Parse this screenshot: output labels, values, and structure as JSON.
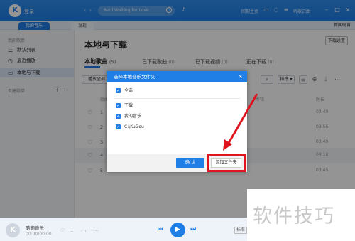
{
  "topbar": {
    "login_label": "登录",
    "search_placeholder": "Avril Waiting for Love",
    "link_1": "回到主页",
    "link_2": "听歌识曲"
  },
  "tabs": [
    {
      "label": "我的音乐"
    },
    {
      "label": "发现"
    }
  ],
  "new_window_label": "新闻码首",
  "sidebar": {
    "section_my": "我的歌单",
    "items": [
      {
        "label": "默认列表",
        "icon": "list-icon"
      },
      {
        "label": "最近播放",
        "icon": "clock-icon"
      },
      {
        "label": "本地与下载",
        "icon": "monitor-icon"
      }
    ],
    "section_created": "自建歌单"
  },
  "main": {
    "title": "本地与下载",
    "download_settings": "下载设置",
    "tabs": [
      {
        "label": "本地歌曲",
        "count": "(5)"
      },
      {
        "label": "已下载歌曲",
        "count": "(0)"
      },
      {
        "label": "已下载视频",
        "count": "(0)"
      },
      {
        "label": "正在下载",
        "count": "(0)"
      }
    ],
    "play_all": "播放全部",
    "sort_label": "排序",
    "col_song": "歌曲",
    "col_album": "专辑",
    "col_duration": "时长",
    "rows": [
      {
        "num": "1",
        "duration": "03:49"
      },
      {
        "num": "2",
        "duration": "03:55"
      },
      {
        "num": "3",
        "duration": "03:49"
      },
      {
        "num": "4",
        "duration": "04:18"
      },
      {
        "num": "5",
        "duration": "03:45"
      }
    ]
  },
  "dialog": {
    "title": "选择本地音乐文件夹",
    "select_all": "全选",
    "folders": [
      "下载",
      "我的音乐",
      "C:\\KuGou"
    ],
    "ok_label": "确 认",
    "add_folder_label": "添加文件夹"
  },
  "player": {
    "title": "酷狗音乐",
    "time": "00:00/00:00",
    "mode_label": "标准"
  },
  "watermark": "软件技巧",
  "colors": {
    "accent": "#1f7fe6",
    "highlight": "#e0141e"
  }
}
